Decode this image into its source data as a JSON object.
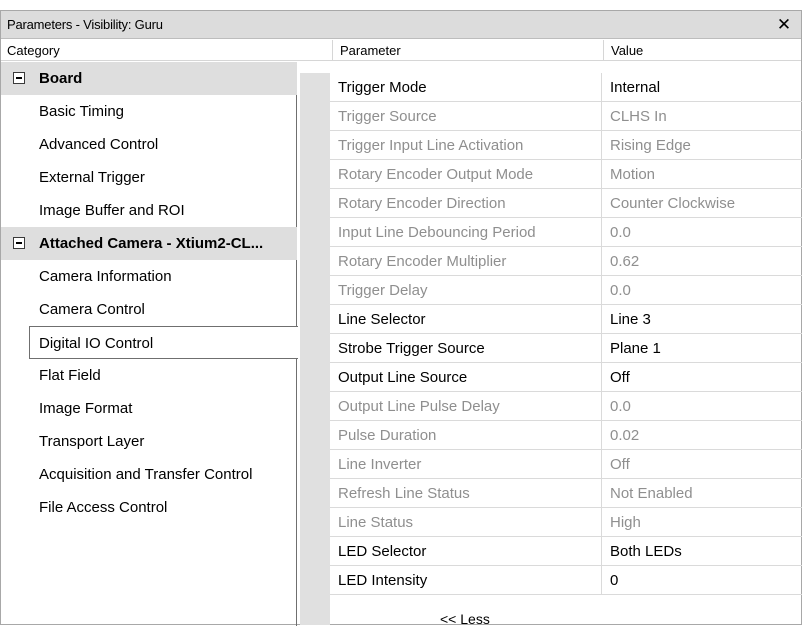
{
  "window": {
    "title": "Parameters - Visibility: Guru",
    "close_glyph": "✕"
  },
  "header": {
    "category": "Category",
    "parameter": "Parameter",
    "value": "Value"
  },
  "categories": [
    {
      "label": "Board",
      "type": "group"
    },
    {
      "label": "Basic Timing",
      "type": "item"
    },
    {
      "label": "Advanced Control",
      "type": "item"
    },
    {
      "label": "External Trigger",
      "type": "item"
    },
    {
      "label": "Image Buffer and ROI",
      "type": "item"
    },
    {
      "label": "Attached Camera - Xtium2-CL...",
      "type": "group"
    },
    {
      "label": "Camera Information",
      "type": "item"
    },
    {
      "label": "Camera Control",
      "type": "item"
    },
    {
      "label": "Digital IO Control",
      "type": "item",
      "selected": true
    },
    {
      "label": "Flat Field",
      "type": "item"
    },
    {
      "label": "Image Format",
      "type": "item"
    },
    {
      "label": "Transport Layer",
      "type": "item"
    },
    {
      "label": "Acquisition and Transfer Control",
      "type": "item"
    },
    {
      "label": "File Access Control",
      "type": "item"
    }
  ],
  "parameters": [
    {
      "name": "Trigger Mode",
      "value": "Internal",
      "enabled": true
    },
    {
      "name": "Trigger Source",
      "value": "CLHS In",
      "enabled": false
    },
    {
      "name": "Trigger Input Line Activation",
      "value": "Rising Edge",
      "enabled": false
    },
    {
      "name": "Rotary Encoder Output Mode",
      "value": "Motion",
      "enabled": false
    },
    {
      "name": "Rotary Encoder Direction",
      "value": "Counter Clockwise",
      "enabled": false
    },
    {
      "name": "Input Line Debouncing Period",
      "value": "0.0",
      "enabled": false
    },
    {
      "name": "Rotary Encoder Multiplier",
      "value": "0.62",
      "enabled": false
    },
    {
      "name": "Trigger Delay",
      "value": "0.0",
      "enabled": false
    },
    {
      "name": "Line Selector",
      "value": "Line 3",
      "enabled": true
    },
    {
      "name": "Strobe Trigger Source",
      "value": "Plane 1",
      "enabled": true
    },
    {
      "name": "Output Line Source",
      "value": "Off",
      "enabled": true
    },
    {
      "name": "Output Line Pulse Delay",
      "value": "0.0",
      "enabled": false
    },
    {
      "name": "Pulse Duration",
      "value": "0.02",
      "enabled": false
    },
    {
      "name": "Line Inverter",
      "value": "Off",
      "enabled": false
    },
    {
      "name": "Refresh Line Status",
      "value": "Not Enabled",
      "enabled": false
    },
    {
      "name": "Line Status",
      "value": "High",
      "enabled": false
    },
    {
      "name": "LED Selector",
      "value": "Both LEDs",
      "enabled": true
    },
    {
      "name": "LED Intensity",
      "value": "0",
      "enabled": true
    }
  ],
  "footer": {
    "less_label": "<< Less"
  },
  "colors": {
    "disabled_text": "#8f8f8f",
    "group_bg": "#dedede",
    "gutter_bg": "#e0e0e0"
  }
}
